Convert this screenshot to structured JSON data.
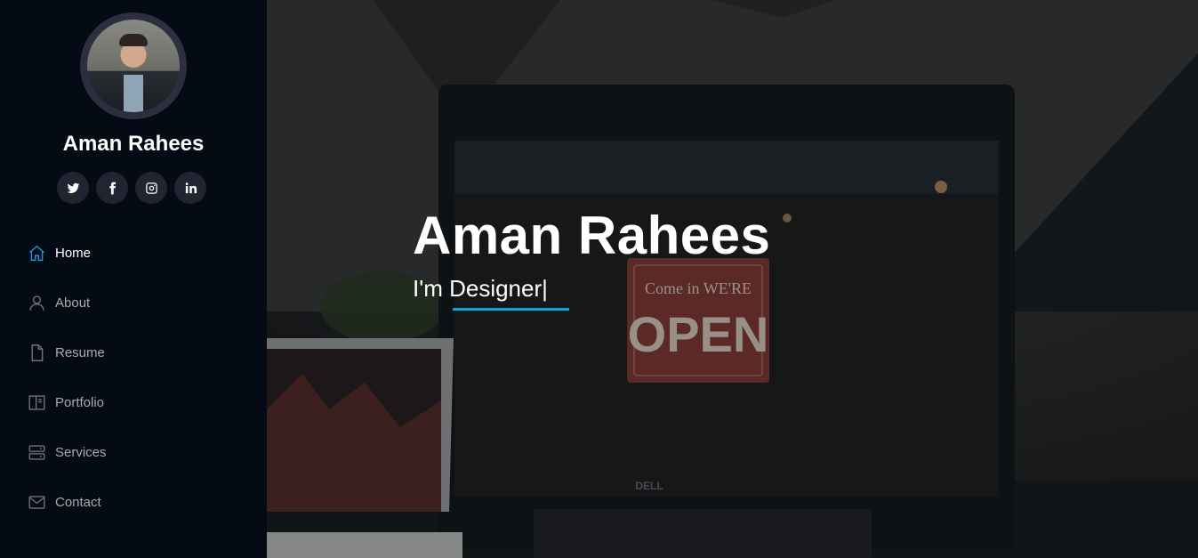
{
  "profile": {
    "name": "Aman Rahees"
  },
  "social": [
    {
      "icon": "twitter-icon"
    },
    {
      "icon": "facebook-icon"
    },
    {
      "icon": "instagram-icon"
    },
    {
      "icon": "linkedin-icon"
    }
  ],
  "nav": [
    {
      "label": "Home",
      "icon": "home-icon",
      "active": true
    },
    {
      "label": "About",
      "icon": "user-icon",
      "active": false
    },
    {
      "label": "Resume",
      "icon": "file-icon",
      "active": false
    },
    {
      "label": "Portfolio",
      "icon": "book-icon",
      "active": false
    },
    {
      "label": "Services",
      "icon": "server-icon",
      "active": false
    },
    {
      "label": "Contact",
      "icon": "envelope-icon",
      "active": false
    }
  ],
  "hero": {
    "title": "Aman Rahees",
    "subtitle_prefix": "I'm ",
    "typed_text": "Designer",
    "cursor": "|",
    "monitor_sign_top": "Come in WE'RE",
    "monitor_sign_main": "OPEN",
    "monitor_brand": "DELL"
  },
  "colors": {
    "accent": "#149ddd",
    "sidebar_bg": "#040b14",
    "social_bg": "#212431"
  }
}
